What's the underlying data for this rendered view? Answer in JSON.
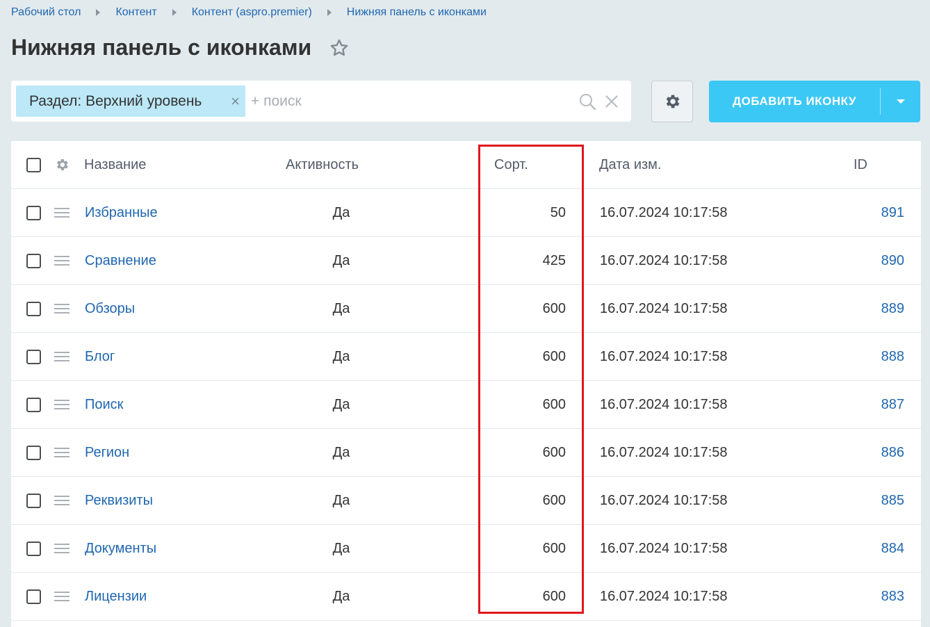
{
  "breadcrumb": [
    "Рабочий стол",
    "Контент",
    "Контент (aspro.premier)",
    "Нижняя панель с иконками"
  ],
  "title": "Нижняя панель с иконками",
  "filter": {
    "tag": "Раздел: Верхний уровень",
    "placeholder": "+ поиск"
  },
  "add_button": {
    "label": "ДОБАВИТЬ ИКОНКУ"
  },
  "columns": {
    "name": "Название",
    "active": "Активность",
    "sort": "Сорт.",
    "date": "Дата изм.",
    "id": "ID"
  },
  "rows": [
    {
      "name": "Избранные",
      "active": "Да",
      "sort": "50",
      "date": "16.07.2024 10:17:58",
      "id": "891"
    },
    {
      "name": "Сравнение",
      "active": "Да",
      "sort": "425",
      "date": "16.07.2024 10:17:58",
      "id": "890"
    },
    {
      "name": "Обзоры",
      "active": "Да",
      "sort": "600",
      "date": "16.07.2024 10:17:58",
      "id": "889"
    },
    {
      "name": "Блог",
      "active": "Да",
      "sort": "600",
      "date": "16.07.2024 10:17:58",
      "id": "888"
    },
    {
      "name": "Поиск",
      "active": "Да",
      "sort": "600",
      "date": "16.07.2024 10:17:58",
      "id": "887"
    },
    {
      "name": "Регион",
      "active": "Да",
      "sort": "600",
      "date": "16.07.2024 10:17:58",
      "id": "886"
    },
    {
      "name": "Реквизиты",
      "active": "Да",
      "sort": "600",
      "date": "16.07.2024 10:17:58",
      "id": "885"
    },
    {
      "name": "Документы",
      "active": "Да",
      "sort": "600",
      "date": "16.07.2024 10:17:58",
      "id": "884"
    },
    {
      "name": "Лицензии",
      "active": "Да",
      "sort": "600",
      "date": "16.07.2024 10:17:58",
      "id": "883"
    }
  ],
  "colors": {
    "accent": "#3bc8f5",
    "link": "#2067b0",
    "highlight": "#e0161c"
  },
  "icons": [
    "chevron-right-icon",
    "star-icon",
    "search-icon",
    "close-icon",
    "gear-icon",
    "drag-handle-icon",
    "chevron-down-icon"
  ]
}
